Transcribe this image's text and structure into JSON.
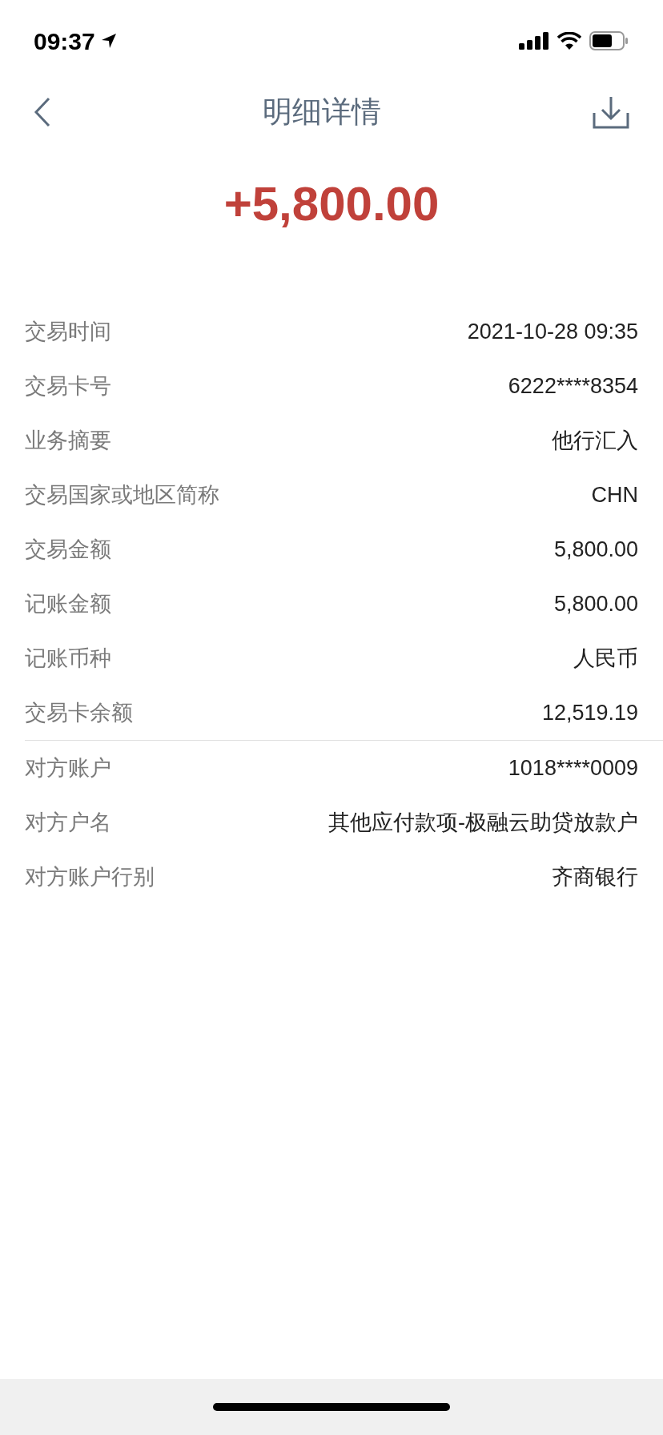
{
  "status_bar": {
    "time": "09:37"
  },
  "header": {
    "title": "明细详情"
  },
  "amount": "+5,800.00",
  "details": [
    {
      "label": "交易时间",
      "value": "2021-10-28 09:35"
    },
    {
      "label": "交易卡号",
      "value": "6222****8354"
    },
    {
      "label": "业务摘要",
      "value": "他行汇入"
    },
    {
      "label": "交易国家或地区简称",
      "value": "CHN"
    },
    {
      "label": "交易金额",
      "value": "5,800.00"
    },
    {
      "label": "记账金额",
      "value": "5,800.00"
    },
    {
      "label": "记账币种",
      "value": "人民币"
    },
    {
      "label": "交易卡余额",
      "value": "12,519.19"
    }
  ],
  "counterparty": [
    {
      "label": "对方账户",
      "value": "1018****0009"
    },
    {
      "label": "对方户名",
      "value": "其他应付款项-极融云助贷放款户"
    },
    {
      "label": "对方账户行别",
      "value": "齐商银行"
    }
  ]
}
